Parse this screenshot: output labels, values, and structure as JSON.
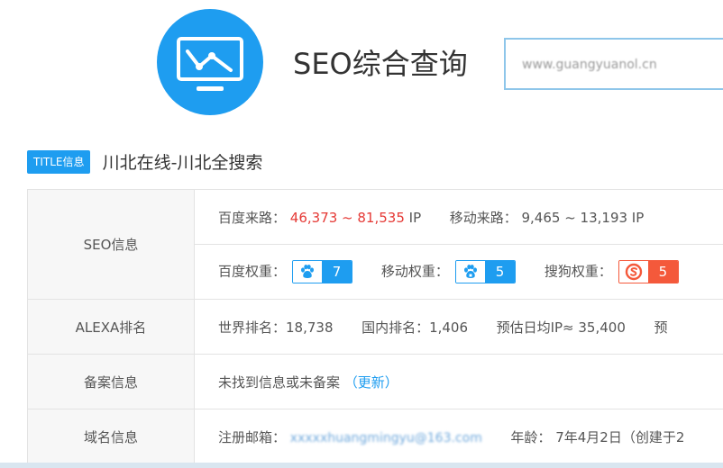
{
  "header": {
    "page_title": "SEO综合查询",
    "search_value": "www.guangyuanol.cn"
  },
  "title_row": {
    "tag": "TITLE信息",
    "text": "川北在线-川北全搜索"
  },
  "rows": {
    "seo": {
      "label": "SEO信息",
      "baidu_traffic_label": "百度来路：",
      "baidu_traffic_value": "46,373 ~ 81,535",
      "baidu_traffic_unit": "IP",
      "mobile_traffic_label": "移动来路：",
      "mobile_traffic_value": "9,465 ~ 13,193 IP",
      "baidu_weight_label": "百度权重：",
      "baidu_weight_value": "7",
      "mobile_weight_label": "移动权重：",
      "mobile_weight_value": "5",
      "sogou_weight_label": "搜狗权重：",
      "sogou_weight_value": "5"
    },
    "alexa": {
      "label": "ALEXA排名",
      "world_rank": "世界排名：18,738",
      "china_rank": "国内排名：1,406",
      "est_ip": "预估日均IP≈ 35,400",
      "est_pv": "预"
    },
    "icp": {
      "label": "备案信息",
      "text": "未找到信息或未备案",
      "update_link": "（更新）"
    },
    "domain": {
      "label": "域名信息",
      "email_label": "注册邮箱：",
      "email_value": "xxxxxhuangmingyu@163.com",
      "age_label": "年龄：",
      "age_value": "7年4月2日（创建于2"
    }
  },
  "colors": {
    "accent": "#1e9df0",
    "red": "#e53935",
    "sogou": "#f4593b"
  }
}
